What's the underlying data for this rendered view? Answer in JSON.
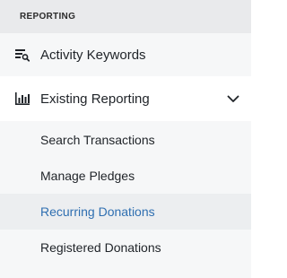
{
  "sidebar": {
    "section_title": "REPORTING",
    "items": [
      {
        "label": "Activity Keywords",
        "icon": "list-search-icon"
      },
      {
        "label": "Existing Reporting",
        "icon": "bar-chart-icon",
        "expanded": true
      }
    ],
    "sub_items": [
      {
        "label": "Search Transactions",
        "active": false
      },
      {
        "label": "Manage Pledges",
        "active": false
      },
      {
        "label": "Recurring Donations",
        "active": true
      },
      {
        "label": "Registered Donations",
        "active": false
      }
    ],
    "colors": {
      "active_text": "#2f6fb1",
      "header_bg": "#e9eaec",
      "sub_bg": "#f6f7f8"
    }
  }
}
